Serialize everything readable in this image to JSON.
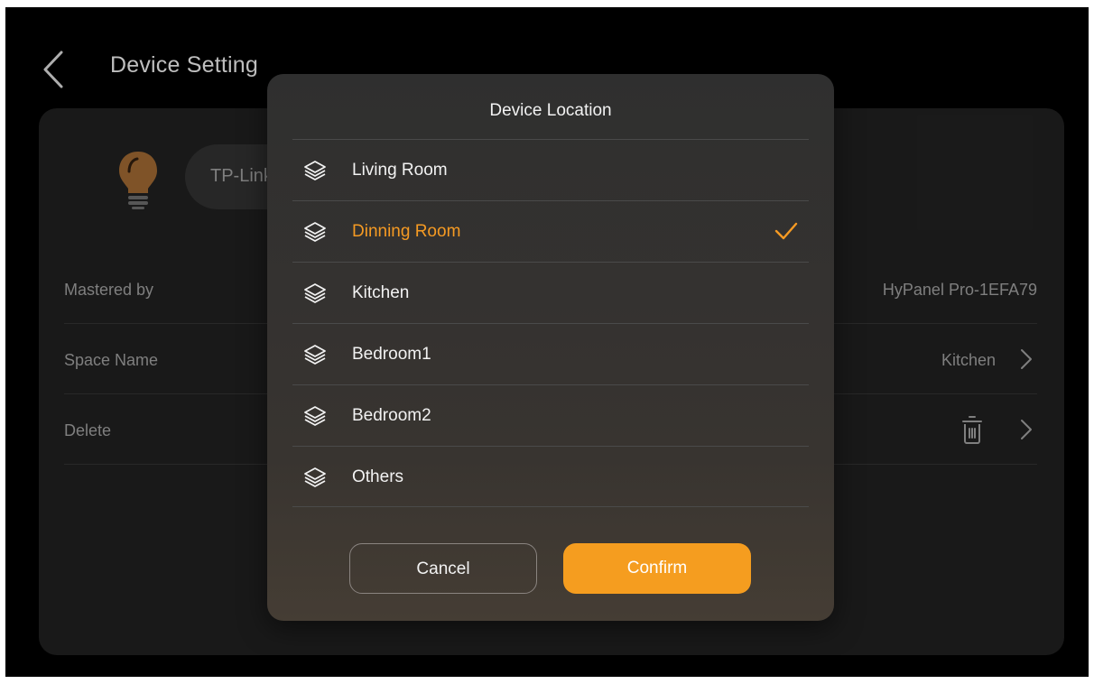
{
  "page": {
    "title": "Device Setting"
  },
  "device": {
    "name_prefix": "TP-Link"
  },
  "rows": {
    "mastered": {
      "label": "Mastered by",
      "value": "HyPanel Pro-1EFA79"
    },
    "space": {
      "label": "Space Name",
      "value": "Kitchen"
    },
    "delete": {
      "label": "Delete"
    }
  },
  "modal": {
    "title": "Device Location",
    "items": [
      {
        "label": "Living Room",
        "icon": "layers-icon",
        "selected": false
      },
      {
        "label": "Dinning Room",
        "icon": "layers-icon",
        "selected": true
      },
      {
        "label": "Kitchen",
        "icon": "layers-icon",
        "selected": false
      },
      {
        "label": "Bedroom1",
        "icon": "layers-icon",
        "selected": false
      },
      {
        "label": "Bedroom2",
        "icon": "layers-icon",
        "selected": false
      },
      {
        "label": "Others",
        "icon": "layers-icon",
        "selected": false
      }
    ],
    "cancel_label": "Cancel",
    "confirm_label": "Confirm"
  },
  "colors": {
    "accent": "#f59d1f",
    "background": "#000000",
    "card": "#1c1c1c"
  }
}
